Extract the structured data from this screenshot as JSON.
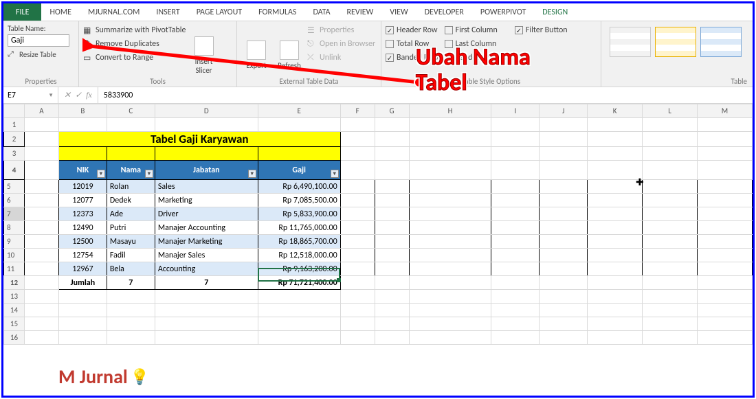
{
  "tabs": [
    "FILE",
    "HOME",
    "MJURNAL.COM",
    "INSERT",
    "PAGE LAYOUT",
    "FORMULAS",
    "DATA",
    "REVIEW",
    "VIEW",
    "DEVELOPER",
    "POWERPIVOT",
    "DESIGN"
  ],
  "ribbon": {
    "properties": {
      "label": "Properties",
      "table_name_label": "Table Name:",
      "table_name_value": "Gaji",
      "resize": "Resize Table"
    },
    "tools": {
      "label": "Tools",
      "items": [
        "Summarize with PivotTable",
        "Remove Duplicates",
        "Convert to Range"
      ],
      "insert": "Insert\nSlicer"
    },
    "external": {
      "label": "External Table Data",
      "export": "Export",
      "refresh": "Refresh",
      "props": "Properties",
      "open": "Open in Browser",
      "unlink": "Unlink"
    },
    "styleopts": {
      "label": "Table Style Options",
      "header": "Header Row",
      "total": "Total Row",
      "banded": "Banded Rows",
      "first": "First Column",
      "last": "Last Column",
      "bcols": "Banded Columns",
      "filter": "Filter Button"
    },
    "styles": {
      "label": "Table"
    }
  },
  "fbar": {
    "name": "E7",
    "value": "5833900"
  },
  "cols": [
    "A",
    "B",
    "C",
    "D",
    "E",
    "F",
    "G",
    "H",
    "I",
    "J",
    "K",
    "L",
    "M"
  ],
  "rows": [
    "1",
    "2",
    "3",
    "4",
    "5",
    "6",
    "7",
    "8",
    "9",
    "10",
    "11",
    "12",
    "13",
    "14",
    "15",
    "16"
  ],
  "table": {
    "title": "Tabel Gaji Karyawan",
    "headers": [
      "NIK",
      "Nama",
      "Jabatan",
      "Gaji"
    ],
    "data": [
      {
        "nik": "12019",
        "nama": "Rolan",
        "jabatan": "Sales",
        "gaji": "Rp   6,490,100.00"
      },
      {
        "nik": "12077",
        "nama": "Dedek",
        "jabatan": "Marketing",
        "gaji": "Rp   7,085,500.00"
      },
      {
        "nik": "12373",
        "nama": "Ade",
        "jabatan": "Driver",
        "gaji": "Rp   5,833,900.00"
      },
      {
        "nik": "12490",
        "nama": "Putri",
        "jabatan": "Manajer Accounting",
        "gaji": "Rp 11,765,000.00"
      },
      {
        "nik": "12500",
        "nama": "Masayu",
        "jabatan": "Manajer Marketing",
        "gaji": "Rp 18,865,700.00"
      },
      {
        "nik": "12754",
        "nama": "Fadil",
        "jabatan": "Manajer Sales",
        "gaji": "Rp 12,518,000.00"
      },
      {
        "nik": "12967",
        "nama": "Bela",
        "jabatan": "Accounting",
        "gaji": "Rp   9,163,200.00"
      }
    ],
    "total": {
      "label": "Jumlah",
      "count1": "7",
      "count2": "7",
      "sum": "Rp 71,721,400.00"
    }
  },
  "annot": "Ubah Nama Tabel",
  "watermark": "M Jurnal"
}
